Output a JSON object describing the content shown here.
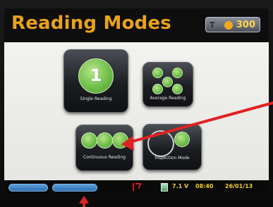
{
  "header": {
    "title": "Reading Modes",
    "logo_brand": "T",
    "logo_number": "300"
  },
  "tiles": {
    "single": {
      "number": "1",
      "label": "Single Reading"
    },
    "average": {
      "label": "Average Reading"
    },
    "continuous": {
      "label": "Continuous Reading"
    },
    "inspection": {
      "label": "Inspection Mode"
    }
  },
  "footer": {
    "left_button": "",
    "right_button": "",
    "voltage": "7.1 V",
    "time": "08:40",
    "date": "26/01/13"
  },
  "colors": {
    "title": "#e8a21c",
    "accent_green": "#6fbf4a",
    "status_yellow": "#f2cf2b",
    "arrow_red": "#e02222",
    "button_blue": "#2d6fb1"
  }
}
